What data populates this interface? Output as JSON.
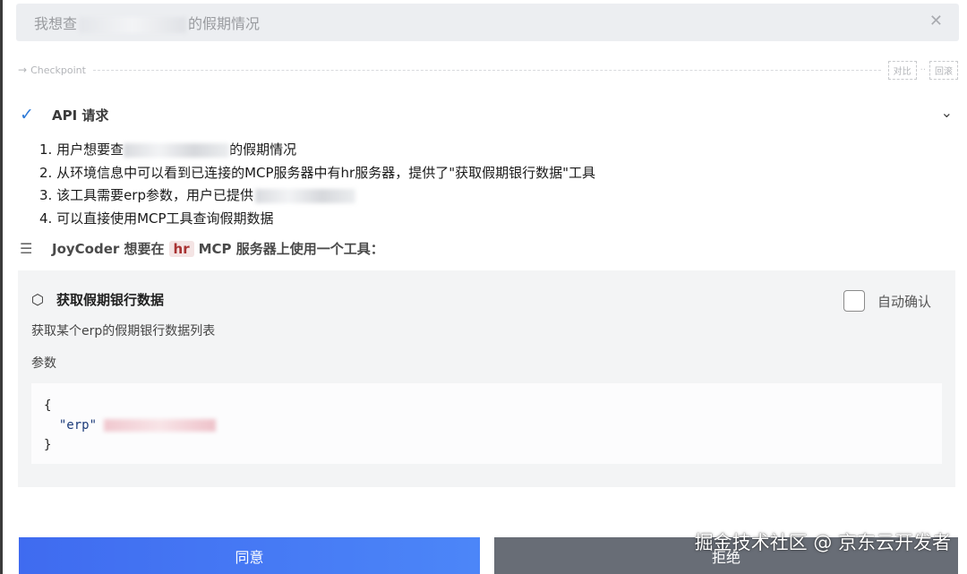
{
  "task": {
    "title_prefix": "我想查",
    "title_suffix": "的假期情况",
    "close_glyph": "✕"
  },
  "checkpoint": {
    "arrow": "→",
    "label": "Checkpoint",
    "compare_label": "对比",
    "separator": "··",
    "rollback_label": "回滚"
  },
  "api_request": {
    "check_glyph": "✓",
    "label": "API 请求",
    "chevron_glyph": "⌄"
  },
  "steps": [
    {
      "prefix": "1. 用户想要查",
      "suffix": "的假期情况"
    },
    {
      "prefix": "2. 从环境信息中可以看到已连接的MCP服务器中有hr服务器，提供了\"获取假期银行数据\"工具",
      "suffix": ""
    },
    {
      "prefix": "3. 该工具需要erp参数，用户已提供",
      "suffix": ""
    },
    {
      "prefix": "4. 可以直接使用MCP工具查询假期数据",
      "suffix": ""
    }
  ],
  "mcp_notice": {
    "icon_glyph": "☰",
    "text_before": "JoyCoder 想要在",
    "server_tag": "hr",
    "text_after": "MCP 服务器上使用一个工具："
  },
  "tool": {
    "icon_glyph": "⬡",
    "name": "获取假期银行数据",
    "auto_confirm_label": "自动确认",
    "auto_confirm_checked": false,
    "description": "获取某个erp的假期银行数据列表",
    "params_label": "参数",
    "code_open": "{",
    "code_key": "\"erp\"",
    "code_close": "}"
  },
  "actions": {
    "agree_label": "同意",
    "reject_label": "拒绝"
  },
  "watermark": "掘金技术社区 @ 京东云开发者",
  "colors": {
    "accent": "#3f6bf0",
    "check": "#2f7bd8",
    "tag_bg": "#f4e4e4",
    "tag_text": "#a83232",
    "reject_bg": "#686d76"
  }
}
